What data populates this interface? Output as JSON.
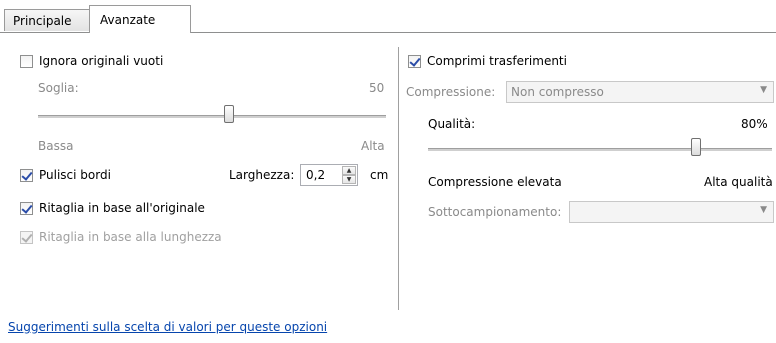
{
  "tabs": [
    {
      "label": "Principale",
      "active": false
    },
    {
      "label": "Avanzate",
      "active": true
    }
  ],
  "left": {
    "ignora": {
      "label": "Ignora originali vuoti",
      "checked": false
    },
    "soglia": {
      "label": "Soglia:",
      "value": "50",
      "min_label": "Bassa",
      "max_label": "Alta",
      "position": 0.55
    },
    "pulisci": {
      "label": "Pulisci bordi",
      "checked": true
    },
    "larghezza": {
      "label": "Larghezza:",
      "value": "0,2",
      "unit": "cm"
    },
    "ritaglia_originale": {
      "label": "Ritaglia in base all'originale",
      "checked": true
    },
    "ritaglia_lunghezza": {
      "label": "Ritaglia in base alla lunghezza",
      "checked": true,
      "disabled": true
    }
  },
  "right": {
    "comprimi": {
      "label": "Comprimi trasferimenti",
      "checked": true
    },
    "compressione": {
      "label": "Compressione:",
      "value": "Non compresso",
      "disabled": true
    },
    "qualita": {
      "label": "Qualità:",
      "value": "80%",
      "position": 0.78
    },
    "compressione_elevata": "Compressione elevata",
    "alta_qualita": "Alta qualità",
    "sottocampionamento": {
      "label": "Sottocampionamento:",
      "value": "",
      "disabled": true
    }
  },
  "help_link": "Suggerimenti sulla scelta di valori per queste opzioni",
  "colors": {
    "accent": "#2b4da8",
    "link": "#0645ad",
    "disabled": "#8a8a8a"
  }
}
